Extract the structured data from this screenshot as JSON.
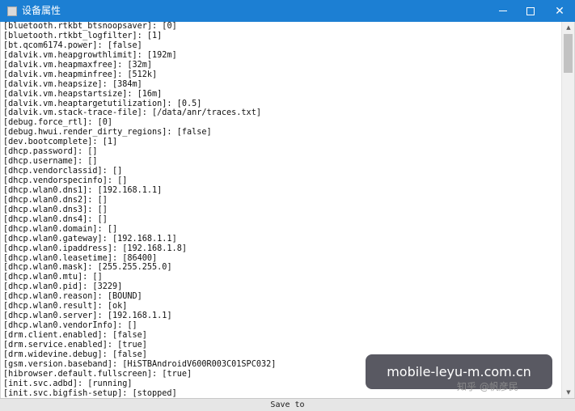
{
  "window": {
    "title": "设备属性",
    "controls": {
      "minimize_icon": "minimize-icon",
      "maximize_icon": "maximize-icon",
      "close_glyph": "✕"
    }
  },
  "properties": [
    {
      "key": "bluetooth.rtkbt_btsnoopsaver",
      "value": "0"
    },
    {
      "key": "bluetooth.rtkbt_logfilter",
      "value": "1"
    },
    {
      "key": "bt.qcom6174.power",
      "value": "false"
    },
    {
      "key": "dalvik.vm.heapgrowthlimit",
      "value": "192m"
    },
    {
      "key": "dalvik.vm.heapmaxfree",
      "value": "32m"
    },
    {
      "key": "dalvik.vm.heapminfree",
      "value": "512k"
    },
    {
      "key": "dalvik.vm.heapsize",
      "value": "384m"
    },
    {
      "key": "dalvik.vm.heapstartsize",
      "value": "16m"
    },
    {
      "key": "dalvik.vm.heaptargetutilization",
      "value": "0.5"
    },
    {
      "key": "dalvik.vm.stack-trace-file",
      "value": "/data/anr/traces.txt"
    },
    {
      "key": "debug.force_rtl",
      "value": "0"
    },
    {
      "key": "debug.hwui.render_dirty_regions",
      "value": "false"
    },
    {
      "key": "dev.bootcomplete",
      "value": "1"
    },
    {
      "key": "dhcp.password",
      "value": ""
    },
    {
      "key": "dhcp.username",
      "value": ""
    },
    {
      "key": "dhcp.vendorclassid",
      "value": ""
    },
    {
      "key": "dhcp.vendorspecinfo",
      "value": ""
    },
    {
      "key": "dhcp.wlan0.dns1",
      "value": "192.168.1.1"
    },
    {
      "key": "dhcp.wlan0.dns2",
      "value": ""
    },
    {
      "key": "dhcp.wlan0.dns3",
      "value": ""
    },
    {
      "key": "dhcp.wlan0.dns4",
      "value": ""
    },
    {
      "key": "dhcp.wlan0.domain",
      "value": ""
    },
    {
      "key": "dhcp.wlan0.gateway",
      "value": "192.168.1.1"
    },
    {
      "key": "dhcp.wlan0.ipaddress",
      "value": "192.168.1.8"
    },
    {
      "key": "dhcp.wlan0.leasetime",
      "value": "86400"
    },
    {
      "key": "dhcp.wlan0.mask",
      "value": "255.255.255.0"
    },
    {
      "key": "dhcp.wlan0.mtu",
      "value": ""
    },
    {
      "key": "dhcp.wlan0.pid",
      "value": "3229"
    },
    {
      "key": "dhcp.wlan0.reason",
      "value": "BOUND"
    },
    {
      "key": "dhcp.wlan0.result",
      "value": "ok"
    },
    {
      "key": "dhcp.wlan0.server",
      "value": "192.168.1.1"
    },
    {
      "key": "dhcp.wlan0.vendorInfo",
      "value": ""
    },
    {
      "key": "drm.client.enabled",
      "value": "false"
    },
    {
      "key": "drm.service.enabled",
      "value": "true"
    },
    {
      "key": "drm.widevine.debug",
      "value": "false"
    },
    {
      "key": "gsm.version.baseband",
      "value": "HiSTBAndroidV600R003C01SPC032"
    },
    {
      "key": "hibrowser.default.fullscreen",
      "value": "true"
    },
    {
      "key": "init.svc.adbd",
      "value": "running"
    },
    {
      "key": "init.svc.bigfish-setup",
      "value": "stopped"
    }
  ],
  "footer": {
    "save_label": "Save to"
  },
  "overlay": {
    "watermark": "mobile-leyu-m.com.cn",
    "credit": "知乎 @帆彦民"
  },
  "scrollbar": {
    "up_glyph": "▲",
    "down_glyph": "▼"
  }
}
